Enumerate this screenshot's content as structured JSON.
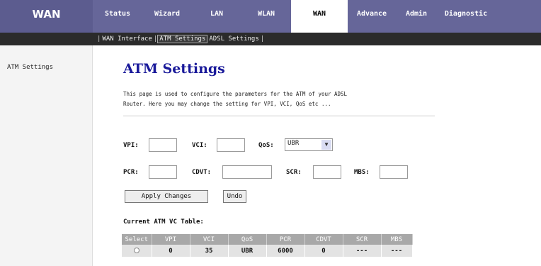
{
  "brand": "WAN",
  "nav": [
    {
      "label": "Status"
    },
    {
      "label": "Wizard"
    },
    {
      "label": "LAN"
    },
    {
      "label": "WLAN"
    },
    {
      "label": "WAN"
    },
    {
      "label": "Advance"
    },
    {
      "label": "Admin"
    },
    {
      "label": "Diagnostic"
    }
  ],
  "subnav": {
    "bracket_open": "|",
    "items": [
      "WAN Interface",
      "ATM Settings",
      "ADSL Settings"
    ],
    "sep": "|",
    "bracket_close": "|"
  },
  "side": {
    "item": "ATM Settings"
  },
  "page": {
    "title": "ATM Settings",
    "desc_line1": "This page is used to configure the parameters for the ATM of your ADSL",
    "desc_line2": "Router. Here you may change the setting for VPI, VCI, QoS etc ..."
  },
  "form": {
    "vpi_label": "VPI:",
    "vpi_value": "",
    "vci_label": "VCI:",
    "vci_value": "",
    "qos_label": "QoS:",
    "qos_selected": "UBR",
    "pcr_label": "PCR:",
    "pcr_value": "",
    "cdvt_label": "CDVT:",
    "cdvt_value": "",
    "scr_label": "SCR:",
    "scr_value": "",
    "mbs_label": "MBS:",
    "mbs_value": "",
    "apply_label": "Apply Changes",
    "undo_label": "Undo"
  },
  "table": {
    "title": "Current ATM VC Table:",
    "headers": [
      "Select",
      "VPI",
      "VCI",
      "QoS",
      "PCR",
      "CDVT",
      "SCR",
      "MBS"
    ],
    "rows": [
      {
        "vpi": "0",
        "vci": "35",
        "qos": "UBR",
        "pcr": "6000",
        "cdvt": "0",
        "scr": "---",
        "mbs": "---"
      }
    ]
  },
  "colors": {
    "nav_bg": "#666699",
    "title": "#1a1a9a",
    "subnav_bg": "#2b2b2b",
    "table_header": "#a8a8a8"
  }
}
